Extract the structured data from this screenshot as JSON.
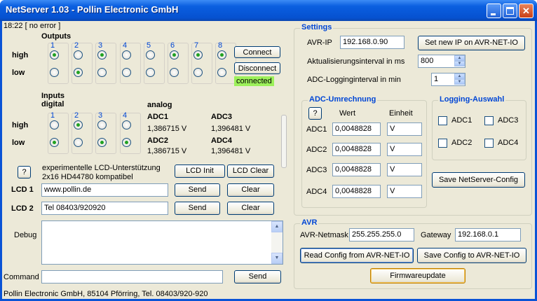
{
  "window": {
    "title": "NetServer 1.03 - Pollin Electronic GmbH"
  },
  "status_top": "18:22 [ no error ]",
  "outputs": {
    "label": "Outputs",
    "numbers": [
      "1",
      "2",
      "3",
      "4",
      "5",
      "6",
      "7",
      "8"
    ],
    "high_label": "high",
    "low_label": "low",
    "high_selected": [
      true,
      false,
      true,
      false,
      false,
      true,
      true,
      true
    ],
    "low_selected": [
      false,
      true,
      false,
      false,
      false,
      false,
      false,
      false
    ]
  },
  "connection": {
    "connect": "Connect",
    "disconnect": "Disconnect",
    "status": "connected"
  },
  "inputs": {
    "label_line1": "Inputs",
    "label_line2": "digital",
    "numbers": [
      "1",
      "2",
      "3",
      "4"
    ],
    "high_selected": [
      false,
      true,
      false,
      false
    ],
    "low_selected": [
      true,
      false,
      true,
      true
    ]
  },
  "analog": {
    "label": "analog",
    "adc1": {
      "name": "ADC1",
      "value": "1,386715 V"
    },
    "adc2": {
      "name": "ADC2",
      "value": "1,386715 V"
    },
    "adc3": {
      "name": "ADC3",
      "value": "1,396481 V"
    },
    "adc4": {
      "name": "ADC4",
      "value": "1,396481 V"
    }
  },
  "lcd": {
    "help": "?",
    "info_line1": "experimentelle LCD-Unterstützung",
    "info_line2": "2x16 HD44780 kompatibel",
    "init": "LCD Init",
    "clear_all": "LCD Clear",
    "lcd1_label": "LCD 1",
    "lcd1_value": "www.pollin.de",
    "lcd2_label": "LCD 2",
    "lcd2_value": "Tel 08403/920920",
    "send": "Send",
    "clear": "Clear"
  },
  "debug": {
    "label": "Debug"
  },
  "command": {
    "label": "Command",
    "send": "Send"
  },
  "footer": "Pollin Electronic GmbH, 85104 Pförring, Tel. 08403/920-920",
  "settings": {
    "title": "Settings",
    "avr_ip_label": "AVR-IP",
    "avr_ip": "192.168.0.90",
    "set_ip": "Set new IP on AVR-NET-IO",
    "refresh_label": "Aktualisierungsinterval in ms",
    "refresh_value": "800",
    "adc_log_label": "ADC-Logginginterval in min",
    "adc_log_value": "1",
    "adc_conv_title": "ADC-Umrechnung",
    "help": "?",
    "wert": "Wert",
    "einheit": "Einheit",
    "rows": [
      {
        "name": "ADC1",
        "wert": "0,0048828",
        "einheit": "V"
      },
      {
        "name": "ADC2",
        "wert": "0,0048828",
        "einheit": "V"
      },
      {
        "name": "ADC3",
        "wert": "0,0048828",
        "einheit": "V"
      },
      {
        "name": "ADC4",
        "wert": "0,0048828",
        "einheit": "V"
      }
    ],
    "logging_title": "Logging-Auswahl",
    "log_adc1": "ADC1",
    "log_adc2": "ADC2",
    "log_adc3": "ADC3",
    "log_adc4": "ADC4",
    "save_config": "Save NetServer-Config"
  },
  "avr": {
    "title": "AVR",
    "netmask_label": "AVR-Netmask",
    "netmask": "255.255.255.0",
    "gateway_label": "Gateway",
    "gateway": "192.168.0.1",
    "read_config": "Read Config from AVR-NET-IO",
    "save_config": "Save Config to AVR-NET-IO",
    "firmware": "Firmwareupdate"
  }
}
